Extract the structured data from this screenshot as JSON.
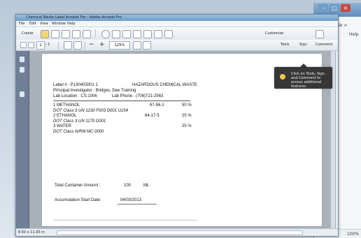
{
  "window": {
    "title": "Chemical Waste Label Acrobat Pro - Adobe Acrobat Pro",
    "controls": [
      "–",
      "□",
      "×"
    ]
  },
  "menu": {
    "items": [
      "File",
      "Edit",
      "View",
      "Window",
      "Help"
    ]
  },
  "toolbar": {
    "create_label": "Create",
    "customize_label": "Customize",
    "page_current": "1",
    "page_total": "/ 1",
    "zoom_value": "125%",
    "tabs": [
      "Tools",
      "Sign",
      "Comment"
    ]
  },
  "tooltip": {
    "text": "Click on Tools, Sign, and Comment to access additional features."
  },
  "document": {
    "label_line": "Label # :  P130403001  1",
    "hazard_title": "HAZARDOUS CHEMICAL WASTE",
    "principal_line": "Principal Investigator :  Bridges, Dee Training",
    "lab_location_line": "Lab Location :  CS:1006",
    "lab_phone_line": "Lab Phone :  (706)721-2563",
    "rows": [
      {
        "name": "1   METHANOL",
        "cas": "67-56-1",
        "pct": "50  %",
        "dot": "DOT Class 3      UN 1230  F003 D001 U154"
      },
      {
        "name": "2   ETHANOL",
        "cas": "64-17-5",
        "pct": "25  %",
        "dot": "DOT Class 3      UN 1170  D001"
      },
      {
        "name": "3   WATER",
        "cas": "",
        "pct": "25  %",
        "dot": "DOT Class N/RM   MC 0000"
      }
    ],
    "total_label": "Total Container Amount :",
    "total_value": "100",
    "total_unit": "ML",
    "accumulation_label": "Accumulation Start Date:",
    "accumulation_value": "04/03/2013"
  },
  "statusbar": {
    "page_size": "8.50 x 11.00 in"
  },
  "background": {
    "right_snippets": [
      "le > ",
      "Help",
      "100%"
    ]
  },
  "colors": {
    "accent": "#6f9bc8",
    "tooltip": "#363636"
  }
}
